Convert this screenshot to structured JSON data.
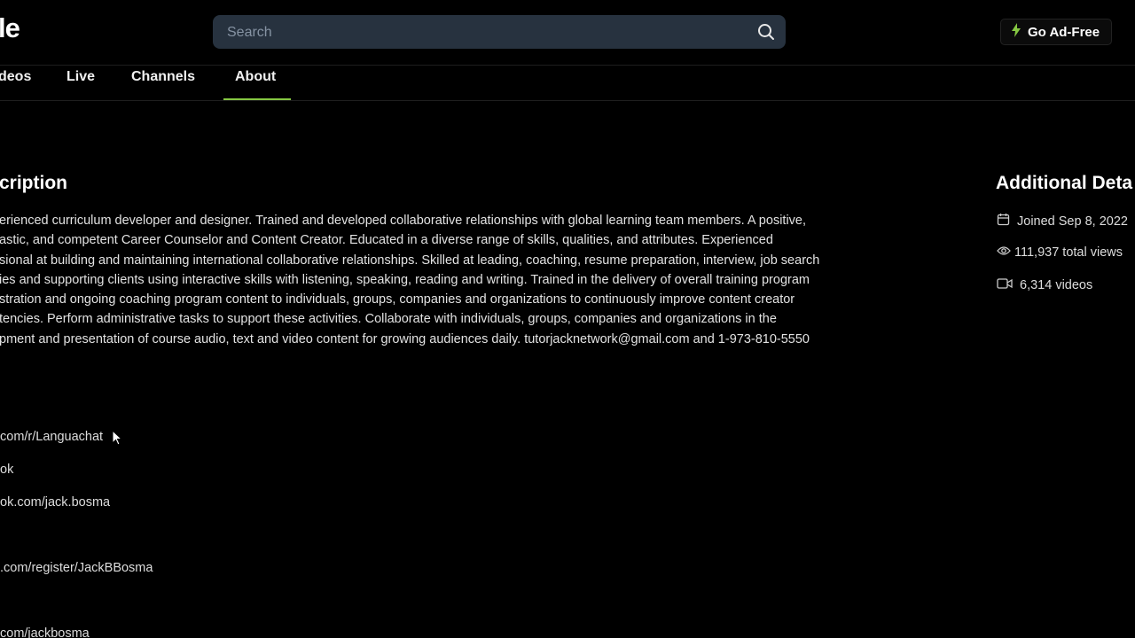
{
  "header": {
    "logo_text": "le",
    "search_placeholder": "Search",
    "ad_free_label": "Go Ad-Free",
    "accent_color": "#85c742"
  },
  "tabs": [
    {
      "label": "deos"
    },
    {
      "label": "Live"
    },
    {
      "label": "Channels"
    },
    {
      "label": "About",
      "active": true
    }
  ],
  "description": {
    "heading": "cription",
    "lines": [
      "erienced curriculum developer and designer. Trained and developed collaborative relationships with global learning team members. A positive,",
      "astic, and competent Career Counselor and Content Creator. Educated in a diverse range of skills, qualities, and attributes. Experienced",
      "sional at building and maintaining international collaborative relationships. Skilled at leading, coaching, resume preparation, interview, job search",
      "ies and supporting clients using interactive skills with listening, speaking, reading and writing. Trained in the delivery of overall training program",
      "stration and ongoing coaching program content to individuals, groups, companies and organizations to continuously improve content creator",
      "tencies. Perform administrative tasks to support these activities. Collaborate with individuals, groups, companies and organizations in the",
      "pment and presentation of course audio, text and video content for growing audiences daily. tutorjacknetwork@gmail.com and 1-973-810-5550"
    ]
  },
  "links": [
    {
      "text": "com/r/Languachat"
    },
    {
      "text": "ok"
    },
    {
      "text": "ok.com/jack.bosma"
    },
    {
      "text": ".com/register/JackBBosma"
    },
    {
      "text": "com/jackbosma"
    }
  ],
  "additional_details": {
    "heading": "Additional Deta",
    "joined": "Joined Sep 8, 2022",
    "views": "111,937 total views",
    "videos": "6,314 videos"
  }
}
